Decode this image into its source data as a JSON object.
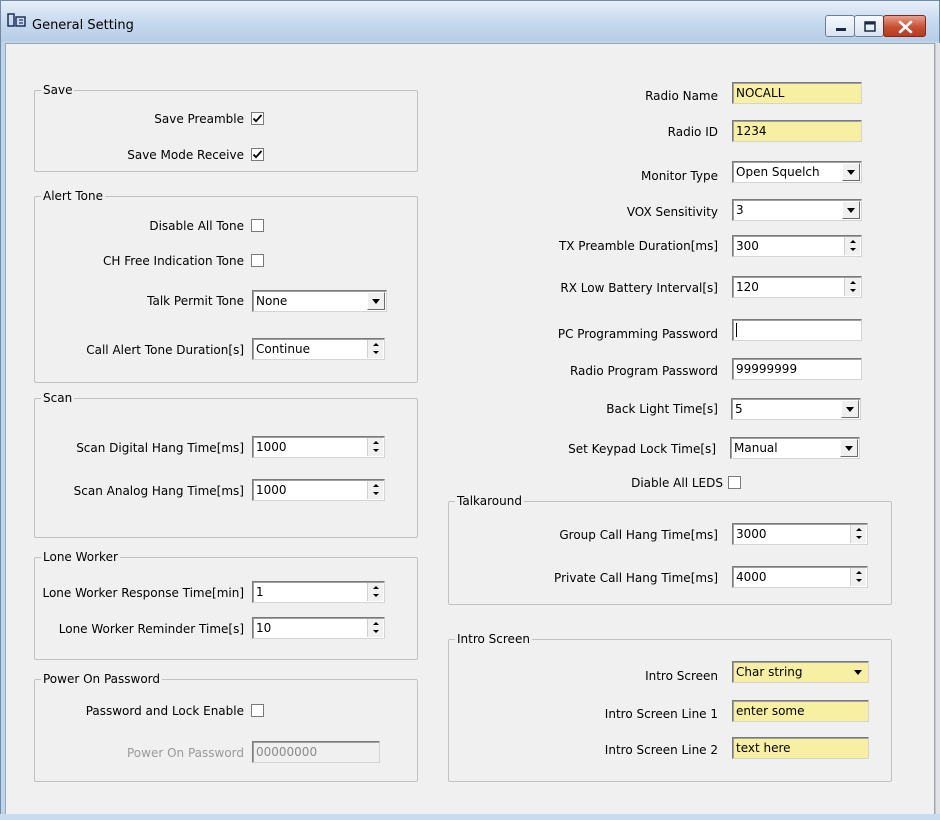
{
  "window": {
    "title": "General Setting"
  },
  "save": {
    "title": "Save",
    "save_preamble": {
      "label": "Save Preamble",
      "checked": true
    },
    "save_mode_receive": {
      "label": "Save Mode Receive",
      "checked": true
    }
  },
  "alert_tone": {
    "title": "Alert Tone",
    "disable_all_tone": {
      "label": "Disable All Tone",
      "checked": false
    },
    "ch_free_indication_tone": {
      "label": "CH Free Indication Tone",
      "checked": false
    },
    "talk_permit_tone": {
      "label": "Talk Permit Tone",
      "value": "None"
    },
    "call_alert_tone_duration": {
      "label": "Call Alert Tone Duration[s]",
      "value": "Continue"
    }
  },
  "scan": {
    "title": "Scan",
    "digital_hang_time": {
      "label": "Scan Digital Hang Time[ms]",
      "value": "1000"
    },
    "analog_hang_time": {
      "label": "Scan Analog Hang Time[ms]",
      "value": "1000"
    }
  },
  "lone_worker": {
    "title": "Lone Worker",
    "response_time": {
      "label": "Lone Worker Response Time[min]",
      "value": "1"
    },
    "reminder_time": {
      "label": "Lone Worker Reminder Time[s]",
      "value": "10"
    }
  },
  "power_on_password": {
    "title": "Power On Password",
    "password_lock_enable": {
      "label": "Password and Lock Enable",
      "checked": false
    },
    "password": {
      "label": "Power On Password",
      "value": "00000000"
    }
  },
  "radio": {
    "radio_name": {
      "label": "Radio Name",
      "value": "NOCALL"
    },
    "radio_id": {
      "label": "Radio ID",
      "value": "1234"
    },
    "monitor_type": {
      "label": "Monitor Type",
      "value": "Open Squelch"
    },
    "vox_sensitivity": {
      "label": "VOX Sensitivity",
      "value": "3"
    },
    "tx_preamble_duration": {
      "label": "TX Preamble Duration[ms]",
      "value": "300"
    },
    "rx_low_battery_interval": {
      "label": "RX Low Battery Interval[s]",
      "value": "120"
    },
    "pc_programming_password": {
      "label": "PC Programming Password",
      "value": ""
    },
    "radio_program_password": {
      "label": "Radio Program Password",
      "value": "99999999"
    },
    "back_light_time": {
      "label": "Back Light Time[s]",
      "value": "5"
    },
    "keypad_lock_time": {
      "label": "Set Keypad Lock Time[s]",
      "value": "Manual"
    },
    "disable_all_leds": {
      "label": "Diable All LEDS",
      "checked": false
    }
  },
  "talkaround": {
    "title": "Talkaround",
    "group_call_hang_time": {
      "label": "Group Call Hang Time[ms]",
      "value": "3000"
    },
    "private_call_hang_time": {
      "label": "Private Call Hang Time[ms]",
      "value": "4000"
    }
  },
  "intro_screen": {
    "title": "Intro Screen",
    "mode": {
      "label": "Intro Screen",
      "value": "Char string"
    },
    "line1": {
      "label": "Intro Screen Line 1",
      "value": "enter some"
    },
    "line2": {
      "label": "Intro Screen Line 2",
      "value": "text here"
    }
  },
  "colors": {
    "highlight_field": "#f7f0a3",
    "dialog_background": "#f0f0f0",
    "close_button": "#c94f33"
  },
  "icons": {
    "app": "radio-settings-icon",
    "minimize": "minimize-icon",
    "maximize": "maximize-icon",
    "close": "close-icon",
    "check": "checkmark-icon"
  }
}
